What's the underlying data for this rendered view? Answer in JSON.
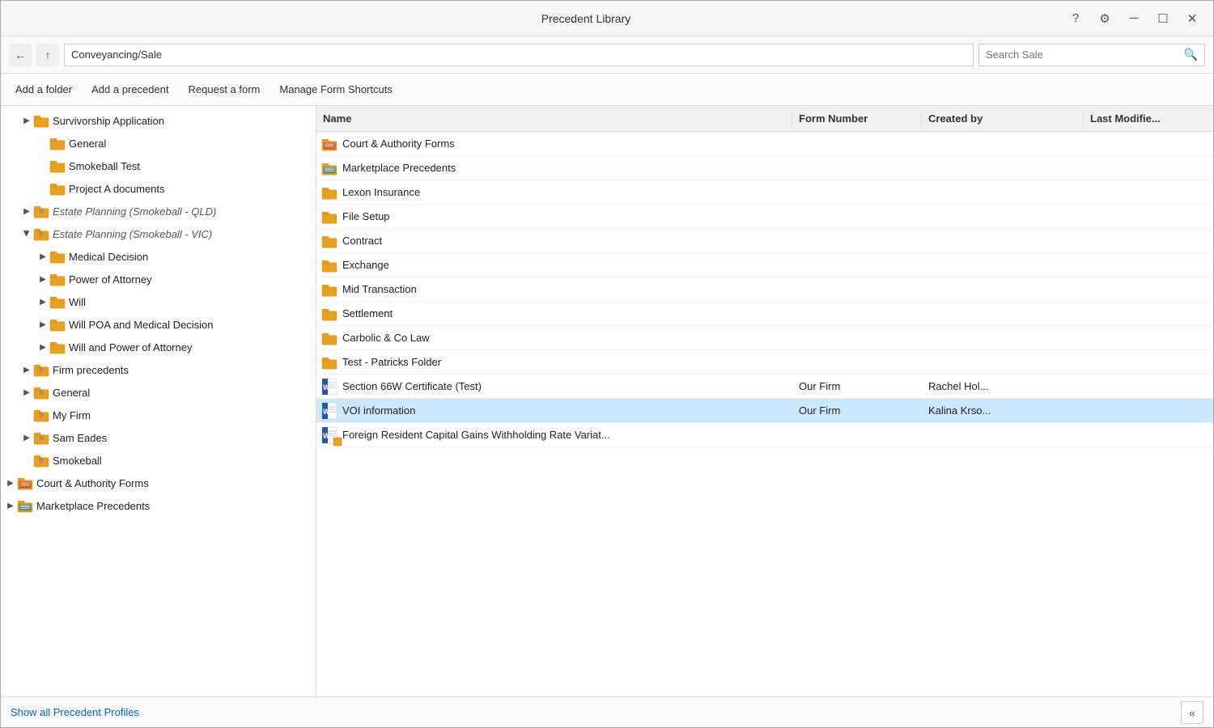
{
  "window": {
    "title": "Precedent Library"
  },
  "titlebar": {
    "help_label": "?",
    "settings_label": "⚙",
    "minimize_label": "─",
    "maximize_label": "☐",
    "close_label": "✕"
  },
  "navbar": {
    "back_label": "←",
    "up_label": "↑",
    "path": "Conveyancing/Sale",
    "search_placeholder": "Search Sale"
  },
  "toolbar": {
    "add_folder": "Add a folder",
    "add_precedent": "Add a precedent",
    "request_form": "Request a form",
    "manage_shortcuts": "Manage Form Shortcuts"
  },
  "columns": {
    "name": "Name",
    "form_number": "Form Number",
    "created_by": "Created by",
    "last_modified": "Last Modifie..."
  },
  "tree": {
    "items": [
      {
        "id": "survivorship",
        "label": "Survivorship Application",
        "indent": 1,
        "icon": "folder",
        "expanded": false,
        "arrow": true
      },
      {
        "id": "general1",
        "label": "General",
        "indent": 2,
        "icon": "folder",
        "expanded": false,
        "arrow": false
      },
      {
        "id": "smokeball-test",
        "label": "Smokeball Test",
        "indent": 2,
        "icon": "folder",
        "expanded": false,
        "arrow": false
      },
      {
        "id": "project-a",
        "label": "Project A documents",
        "indent": 2,
        "icon": "folder",
        "expanded": false,
        "arrow": false
      },
      {
        "id": "estate-qld",
        "label": "Estate Planning (Smokeball - QLD)",
        "indent": 1,
        "icon": "folder-special",
        "expanded": false,
        "arrow": true,
        "italic": true
      },
      {
        "id": "estate-vic",
        "label": "Estate Planning (Smokeball - VIC)",
        "indent": 1,
        "icon": "folder-special",
        "expanded": true,
        "arrow": true,
        "italic": true
      },
      {
        "id": "medical",
        "label": "Medical Decision",
        "indent": 2,
        "icon": "folder",
        "expanded": false,
        "arrow": true
      },
      {
        "id": "poa",
        "label": "Power of Attorney",
        "indent": 2,
        "icon": "folder",
        "expanded": false,
        "arrow": true
      },
      {
        "id": "will",
        "label": "Will",
        "indent": 2,
        "icon": "folder",
        "expanded": false,
        "arrow": true
      },
      {
        "id": "will-poa-med",
        "label": "Will POA and Medical Decision",
        "indent": 2,
        "icon": "folder",
        "expanded": false,
        "arrow": true
      },
      {
        "id": "will-poa",
        "label": "Will and Power of Attorney",
        "indent": 2,
        "icon": "folder",
        "expanded": false,
        "arrow": true
      },
      {
        "id": "firm-precedents",
        "label": "Firm precedents",
        "indent": 1,
        "icon": "folder-special",
        "expanded": false,
        "arrow": true
      },
      {
        "id": "general2",
        "label": "General",
        "indent": 1,
        "icon": "folder-special",
        "expanded": false,
        "arrow": true
      },
      {
        "id": "my-firm",
        "label": "My Firm",
        "indent": 1,
        "icon": "folder-special",
        "expanded": false,
        "arrow": false
      },
      {
        "id": "sam-eades",
        "label": "Sam Eades",
        "indent": 1,
        "icon": "folder-special",
        "expanded": false,
        "arrow": true
      },
      {
        "id": "smokeball",
        "label": "Smokeball",
        "indent": 1,
        "icon": "folder-special",
        "expanded": false,
        "arrow": false
      },
      {
        "id": "court-forms",
        "label": "Court & Authority Forms",
        "indent": 0,
        "icon": "court",
        "expanded": false,
        "arrow": true
      },
      {
        "id": "marketplace",
        "label": "Marketplace Precedents",
        "indent": 0,
        "icon": "marketplace",
        "expanded": false,
        "arrow": true
      }
    ]
  },
  "list_items": [
    {
      "id": "court-authority",
      "name": "Court & Authority Forms",
      "icon": "court",
      "form_number": "",
      "created_by": "",
      "last_modified": ""
    },
    {
      "id": "marketplace-prec",
      "name": "Marketplace Precedents",
      "icon": "marketplace",
      "form_number": "",
      "created_by": "",
      "last_modified": ""
    },
    {
      "id": "lexon",
      "name": "Lexon Insurance",
      "icon": "folder",
      "form_number": "",
      "created_by": "",
      "last_modified": ""
    },
    {
      "id": "file-setup",
      "name": "File Setup",
      "icon": "folder",
      "form_number": "",
      "created_by": "",
      "last_modified": ""
    },
    {
      "id": "contract",
      "name": "Contract",
      "icon": "folder",
      "form_number": "",
      "created_by": "",
      "last_modified": ""
    },
    {
      "id": "exchange",
      "name": "Exchange",
      "icon": "folder",
      "form_number": "",
      "created_by": "",
      "last_modified": ""
    },
    {
      "id": "mid-transaction",
      "name": "Mid Transaction",
      "icon": "folder",
      "form_number": "",
      "created_by": "",
      "last_modified": ""
    },
    {
      "id": "settlement",
      "name": "Settlement",
      "icon": "folder",
      "form_number": "",
      "created_by": "",
      "last_modified": ""
    },
    {
      "id": "carbolic",
      "name": "Carbolic & Co Law",
      "icon": "folder",
      "form_number": "",
      "created_by": "",
      "last_modified": ""
    },
    {
      "id": "test-patricks",
      "name": "Test - Patricks Folder",
      "icon": "folder",
      "form_number": "",
      "created_by": "",
      "last_modified": ""
    },
    {
      "id": "section-66w",
      "name": "Section 66W Certificate (Test)",
      "icon": "word",
      "form_number": "Our Firm",
      "created_by": "Rachel Hol...",
      "last_modified": ""
    },
    {
      "id": "voi",
      "name": "VOI information",
      "icon": "word",
      "form_number": "Our Firm",
      "created_by": "Kalina Krso...",
      "last_modified": "",
      "selected": true
    },
    {
      "id": "foreign-resident",
      "name": "Foreign Resident Capital Gains Withholding Rate Variat...",
      "icon": "word-special",
      "form_number": "",
      "created_by": "",
      "last_modified": ""
    }
  ],
  "bottom": {
    "show_profiles": "Show all Precedent Profiles",
    "collapse_label": "«"
  }
}
